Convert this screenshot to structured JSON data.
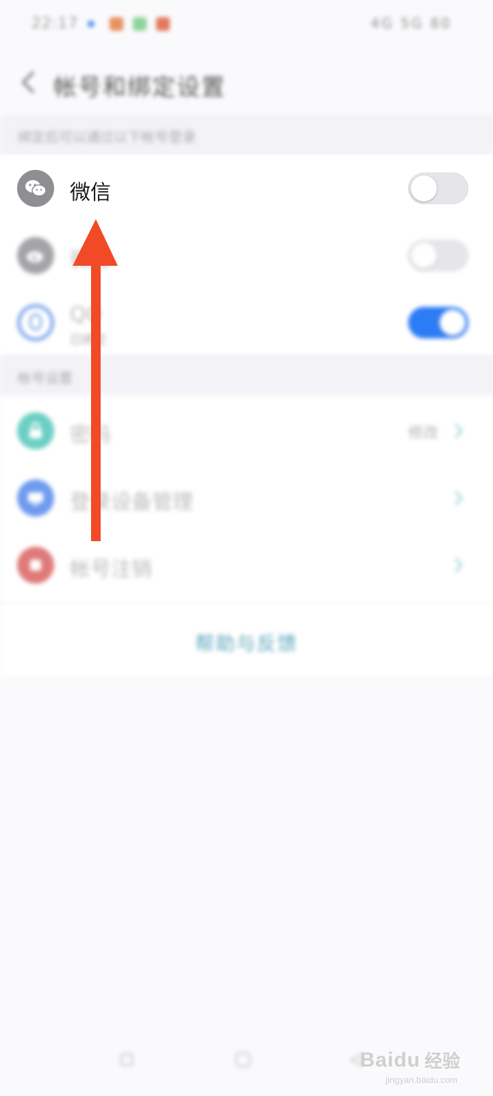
{
  "status_bar": {
    "time": "22:17",
    "right_text": "4G 5G 80"
  },
  "header": {
    "title": "帐号和绑定设置"
  },
  "sections": [
    {
      "label": "绑定后可以通过以下帐号登录"
    },
    {
      "label": "帐号设置"
    }
  ],
  "bindings": [
    {
      "label": "微信",
      "sub": "",
      "icon": "wechat-icon",
      "toggle_on": false,
      "color": "#8e8e93"
    },
    {
      "label": "微博",
      "sub": "",
      "icon": "weibo-icon",
      "toggle_on": false,
      "color": "#a3a3a8"
    },
    {
      "label": "QQ",
      "sub": "已绑定",
      "icon": "qq-icon",
      "toggle_on": true,
      "color": "#7ba6ec"
    }
  ],
  "account_items": [
    {
      "label": "密码",
      "value": "修改",
      "icon": "lock-icon",
      "color": "#6ccfc3"
    },
    {
      "label": "登录设备管理",
      "value": "",
      "icon": "device-icon",
      "color": "#6f9bef"
    },
    {
      "label": "帐号注销",
      "value": "",
      "icon": "cancel-icon",
      "color": "#e07a7a"
    }
  ],
  "footer_link": "帮助与反馈",
  "watermark": {
    "main": "Baidu",
    "cn": "经验",
    "sub": "jingyan.baidu.com"
  },
  "colors": {
    "annotation_arrow": "#f04a26",
    "toggle_on": "#2c7cf6",
    "toggle_off": "#e5e5ea"
  }
}
